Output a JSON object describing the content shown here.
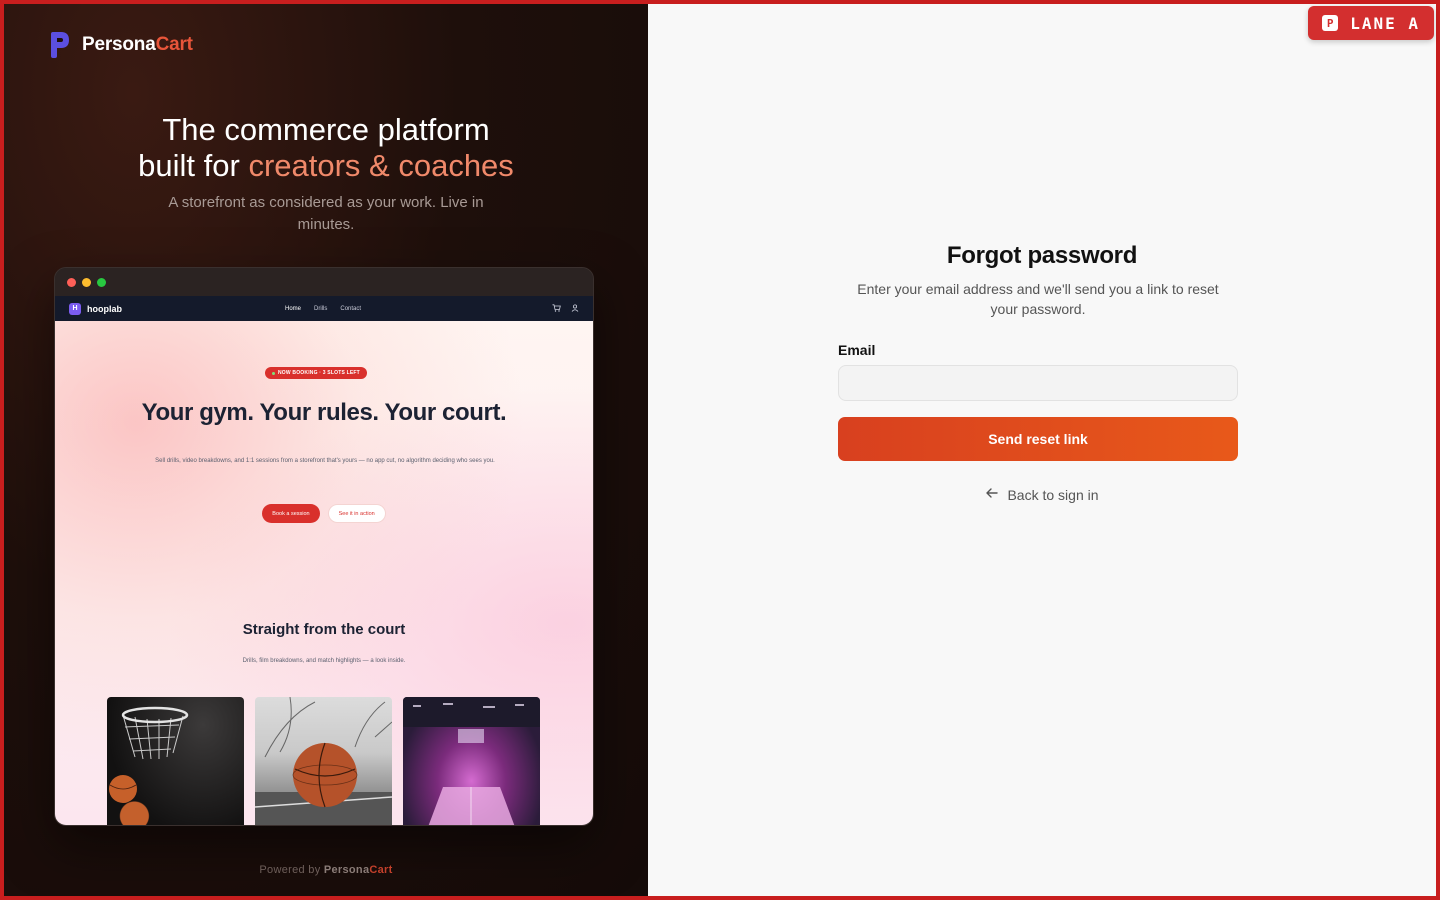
{
  "brand": {
    "name_a": "Persona",
    "name_b": "Cart",
    "accent": "#e8553a"
  },
  "hero": {
    "line1": "The commerce platform",
    "line2_a": "built for ",
    "line2_b": "creators & coaches",
    "subtitle": "A storefront as considered as your work. Live in minutes."
  },
  "mock": {
    "logo_letter": "H",
    "logo_name": "hooplab",
    "nav": [
      "Home",
      "Drills",
      "Contact"
    ],
    "badge": "NOW BOOKING · 3 SLOTS LEFT",
    "headline": "Your gym. Your rules. Your court.",
    "description": "Sell drills, video breakdowns, and 1:1 sessions from a storefront that's yours — no app cut, no algorithm deciding who sees you.",
    "primary_cta": "Book a session",
    "secondary_cta": "See it in action",
    "section_title": "Straight from the court",
    "section_sub": "Drills, film breakdowns, and match highlights — a look inside."
  },
  "footer": {
    "powered_by": "Powered by",
    "name_a": "Persona",
    "name_b": "Cart"
  },
  "form": {
    "title": "Forgot password",
    "subtitle": "Enter your email address and we'll send you a link to reset your password.",
    "email_label": "Email",
    "email_value": "",
    "submit_label": "Send reset link",
    "back_label": "Back to sign in"
  },
  "lane_badge": {
    "icon": "P",
    "label": "LANE A"
  },
  "colors": {
    "frame": "#c81e1e",
    "cta": "#e0501c"
  }
}
